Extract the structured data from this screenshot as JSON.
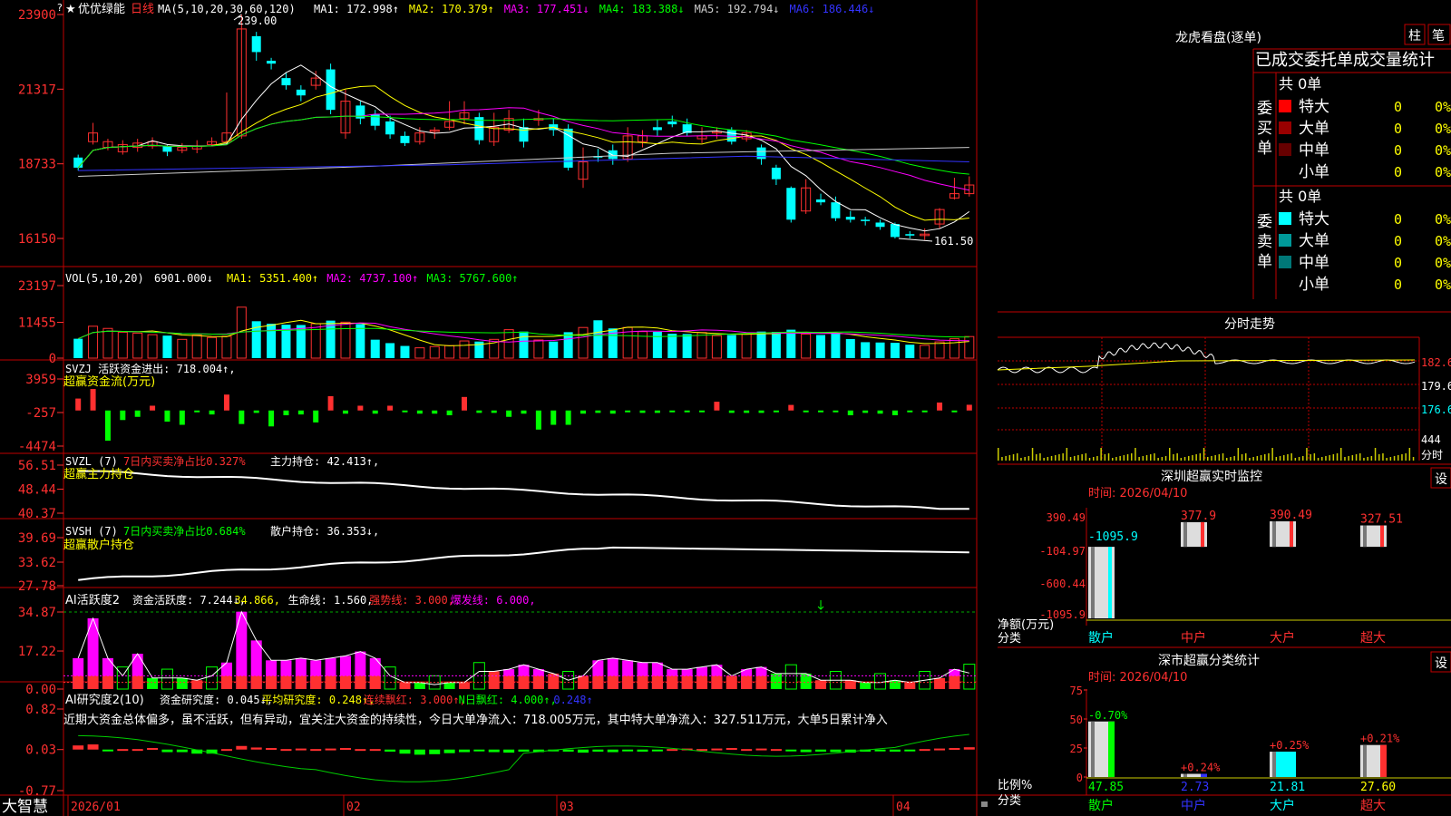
{
  "header": {
    "star": "★",
    "stock_name": "优优绿能",
    "period": "日线",
    "ma_label": "MA(5,10,20,30,60,120)",
    "ma_items": [
      {
        "text": "MA1: 172.998↑",
        "color": "#ffffff"
      },
      {
        "text": "MA2: 170.379↑",
        "color": "#ffff00"
      },
      {
        "text": "MA3: 177.451↓",
        "color": "#ff00ff"
      },
      {
        "text": "MA4: 183.388↓",
        "color": "#00ff00"
      },
      {
        "text": "MA5: 192.794↓",
        "color": "#cccccc"
      },
      {
        "text": "MA6: 186.446↓",
        "color": "#3333ff"
      }
    ],
    "high_marker": "239.00",
    "low_marker": "161.50",
    "top_badge": "?"
  },
  "price_axis": [
    "23900",
    "21317",
    "18733",
    "16150"
  ],
  "vol_panel": {
    "title": "VOL(5,10,20)",
    "value": "6901.000↓",
    "items": [
      {
        "text": "MA1: 5351.400↑",
        "color": "#ffff00"
      },
      {
        "text": "MA2: 4737.100↑",
        "color": "#ff00ff"
      },
      {
        "text": "MA3: 5767.600↑",
        "color": "#00ff00"
      }
    ],
    "axis": [
      "23197",
      "11455",
      "0"
    ]
  },
  "svzj_panel": {
    "title": "SVZJ  活跃资金进出: 718.004↑,",
    "subtitle": "超赢资金流(万元)",
    "axis": [
      "3959",
      "-257",
      "-4474"
    ]
  },
  "svzl_panel": {
    "title": "SVZL (7)",
    "part1": "7日内买卖净占比0.327%",
    "part2": "主力持仓: 42.413↑,",
    "subtitle": "超赢主力持仓",
    "axis": [
      "56.51",
      "48.44",
      "40.37"
    ]
  },
  "svsh_panel": {
    "title": "SVSH (7)",
    "part1": "7日内买卖净占比0.684%",
    "part2": "散户持仓: 36.353↓,",
    "subtitle": "超赢散户持仓",
    "axis": [
      "39.69",
      "33.62",
      "27.78"
    ]
  },
  "ai1_panel": {
    "title": "AI活跃度2",
    "items": [
      {
        "text": "资金活跃度: 7.244↓,",
        "color": "#ffffff"
      },
      {
        "text": "34.866,",
        "color": "#ffff00"
      },
      {
        "text": "生命线: 1.560,",
        "color": "#ffffff"
      },
      {
        "text": "强势线: 3.000,",
        "color": "#ff3030"
      },
      {
        "text": "爆发线: 6.000,",
        "color": "#ff00ff"
      }
    ],
    "axis": [
      "34.87",
      "17.22",
      "0.00"
    ]
  },
  "ai2_panel": {
    "title": "AI研究度2(10)",
    "items": [
      {
        "text": "资金研究度: 0.045↓,",
        "color": "#ffffff"
      },
      {
        "text": "平均研究度: 0.248↑,",
        "color": "#ffff00"
      },
      {
        "text": "连续飘红: 3.000↑,",
        "color": "#ff3030"
      },
      {
        "text": "N日飘红: 4.000↑,",
        "color": "#00ff00"
      },
      {
        "text": "0.248↑",
        "color": "#3333ff"
      }
    ],
    "comment": "近期大资金总体偏多，虽不活跃，但有异动，宜关注大资金的持续性，今日大单净流入：718.005万元，其中特大单净流入：327.511万元，大单5日累计净入",
    "axis": [
      "0.82",
      "0.03",
      "-0.77"
    ]
  },
  "date_axis": [
    "2026/01",
    "02",
    "03",
    "04"
  ],
  "app_logo": "大智慧",
  "right_panel": {
    "lhb_title": "龙虎看盘(逐单)",
    "tab_bar": "柱",
    "tab_pen": "笔",
    "tabs_row": [
      "已成交",
      "委托单",
      "成交量",
      "统计"
    ],
    "buy_label": "委买单",
    "sell_label": "委卖单",
    "buy_total": "共 0单",
    "sell_total": "共 0单",
    "buy_rows": [
      {
        "label": "特大",
        "count": "0",
        "pct": "0%",
        "color": "#ff0000"
      },
      {
        "label": "大单",
        "count": "0",
        "pct": "0%",
        "color": "#990000"
      },
      {
        "label": "中单",
        "count": "0",
        "pct": "0%",
        "color": "#660000"
      },
      {
        "label": "小单",
        "count": "0",
        "pct": "0%",
        "color": ""
      }
    ],
    "sell_rows": [
      {
        "label": "特大",
        "count": "0",
        "pct": "0%",
        "color": "#00ffff"
      },
      {
        "label": "大单",
        "count": "0",
        "pct": "0%",
        "color": "#009999"
      },
      {
        "label": "中单",
        "count": "0",
        "pct": "0%",
        "color": "#007777"
      },
      {
        "label": "小单",
        "count": "0",
        "pct": "0%",
        "color": ""
      }
    ],
    "intraday_title": "分时走势",
    "intraday_axis": [
      "182.6",
      "179.6",
      "176.6",
      "444"
    ],
    "intraday_unit": "分时",
    "sz_monitor_title": "深圳超赢实时监控",
    "sz_monitor_button": "设",
    "sz_time": "时间: 2026/04/10",
    "sz_axis": [
      "390.49",
      "-104.97",
      "-600.44",
      "-1095.9"
    ],
    "sz_bar_labels": [
      "-1095.9",
      "377.9",
      "390.49",
      "327.51"
    ],
    "sz_net_label": "净额(万元)",
    "sz_cat_label": "分类",
    "sz_categories": [
      "散户",
      "中户",
      "大户",
      "超大"
    ],
    "sz_values": [
      -1095.9,
      377.9,
      390.49,
      327.51
    ],
    "stat_title": "深市超赢分类统计",
    "stat_button": "设",
    "stat_time": "时间: 2026/04/10",
    "stat_axis": [
      "75",
      "50",
      "25",
      "0"
    ],
    "stat_ratio_label": "比例%",
    "stat_cat_label": "分类",
    "stat_top_labels": [
      "-0.70%",
      "+0.24%",
      "+0.25%",
      "+0.21%"
    ],
    "stat_values": [
      "47.85",
      "2.73",
      "21.81",
      "27.60"
    ],
    "stat_categories": [
      "散户",
      "中户",
      "大户",
      "超大"
    ]
  },
  "colors": {
    "up": "#ff3333",
    "down": "#00ffff",
    "frame": "#c00000",
    "grid": "#800000"
  }
}
